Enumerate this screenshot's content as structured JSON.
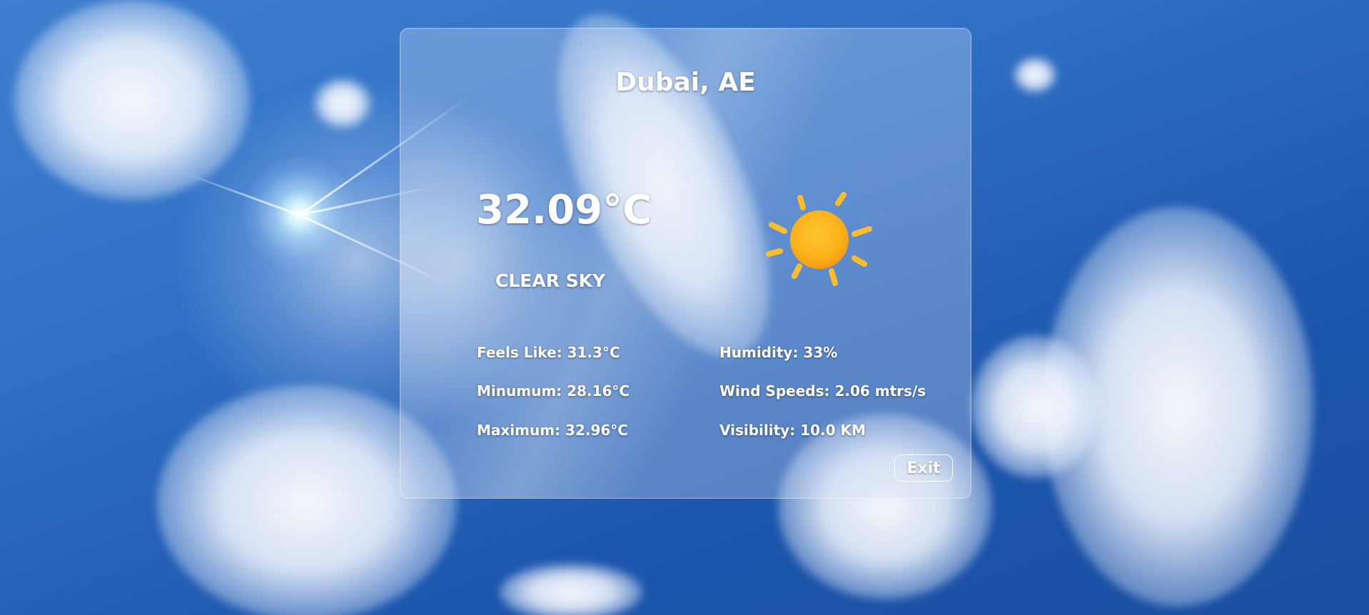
{
  "weather": {
    "location": "Dubai, AE",
    "temperature": "32.09°C",
    "condition": "CLEAR SKY",
    "icon": "sun-icon",
    "stats": {
      "feels_like": "Feels Like: 31.3°C",
      "minimum": "Minumum: 28.16°C",
      "maximum": "Maximum: 32.96°C",
      "humidity": "Humidity: 33%",
      "wind_speed": "Wind Speeds: 2.06 mtrs/s",
      "visibility": "Visibility: 10.0 KM"
    }
  },
  "actions": {
    "exit_label": "Exit"
  },
  "colors": {
    "sky": "#2f6fc4",
    "text": "#ffffff",
    "sun": "#fbb11c",
    "sun_rays": "#fbbd2a"
  }
}
